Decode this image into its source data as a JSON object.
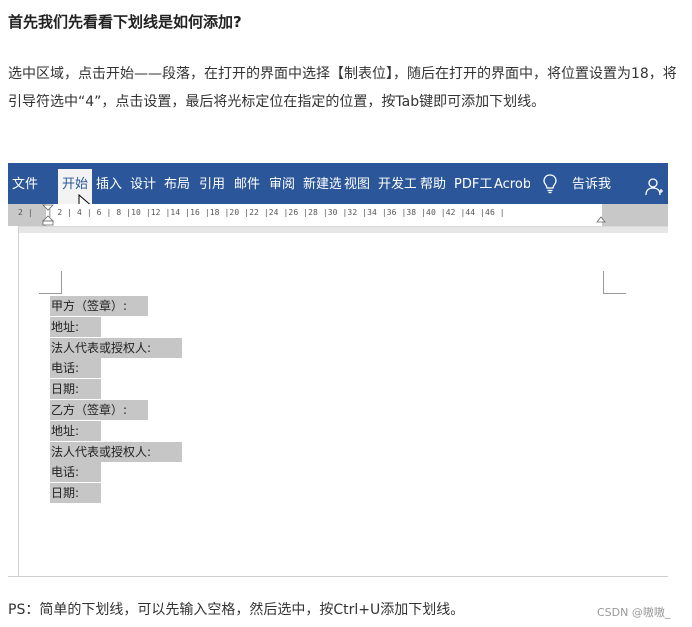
{
  "article": {
    "heading": "首先我们先看看下划线是如何添加?",
    "paragraph": "选中区域，点击开始——段落，在打开的界面中选择【制表位】，随后在打开的界面中，将位置设置为18，将引导符选中“4”，点击设置，最后将光标定位在指定的位置，按Tab键即可添加下划线。",
    "ps": "PS：简单的下划线，可以先输入空格，然后选中，按Ctrl+U添加下划线。",
    "watermark": "CSDN @嗷嗷_"
  },
  "word": {
    "ribbon_tabs": [
      {
        "label": "文件"
      },
      {
        "label": "开始",
        "active": true
      },
      {
        "label": "插入"
      },
      {
        "label": "设计"
      },
      {
        "label": "布局"
      },
      {
        "label": "引用"
      },
      {
        "label": "邮件"
      },
      {
        "label": "审阅"
      },
      {
        "label": "新建选"
      },
      {
        "label": "视图"
      },
      {
        "label": "开发工"
      },
      {
        "label": "帮助"
      },
      {
        "label": "PDF工"
      },
      {
        "label": "Acrob"
      }
    ],
    "tell_me": "告诉我",
    "ruler_text": "2 |   | 2 | 4 | 6 | 8 |10 |12 |14 |16 |18 |20 |22 |24 |26 |28 |30 |32 |34 |36 |38 |40 |42 |44 |46 |",
    "doc_lines": [
      "甲方（签章）:",
      "地址:",
      "法人代表或授权人:",
      "电话:",
      "日期:",
      "乙方（签章）:",
      "地址:",
      "法人代表或授权人:",
      "电话:",
      "日期:"
    ]
  },
  "colors": {
    "ribbon": "#2b579a",
    "selection": "#c6c6c6"
  },
  "icons": [
    "cursor-arrow-icon",
    "lightbulb-icon",
    "person-icon"
  ]
}
